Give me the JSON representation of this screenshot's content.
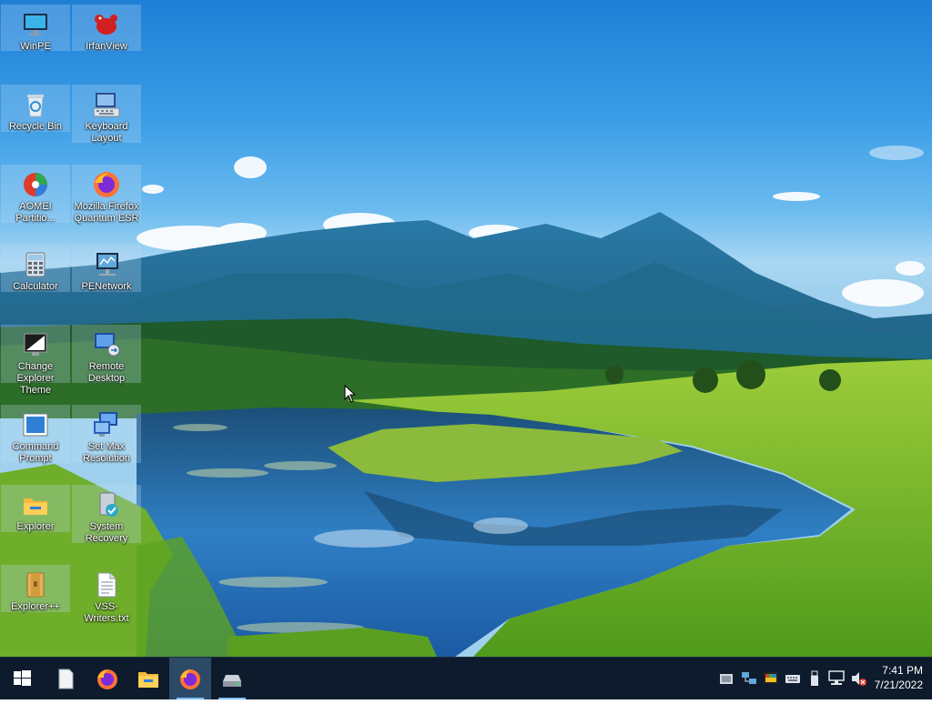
{
  "desktop": {
    "icons": [
      {
        "label": "WinPE",
        "icon": "monitor-icon"
      },
      {
        "label": "IrfanView",
        "icon": "irfanview-icon"
      },
      {
        "label": "Recycle Bin",
        "icon": "recycle-bin-icon"
      },
      {
        "label": "Keyboard Layout",
        "icon": "keyboard-icon"
      },
      {
        "label": "AOMEI Partitio...",
        "icon": "aomei-partition-icon"
      },
      {
        "label": "Mozilla Firefox Quantum ESR",
        "icon": "firefox-icon"
      },
      {
        "label": "Calculator",
        "icon": "calculator-icon"
      },
      {
        "label": "PENetwork",
        "icon": "network-icon"
      },
      {
        "label": "Change Explorer Theme",
        "icon": "theme-icon"
      },
      {
        "label": "Remote Desktop",
        "icon": "remote-desktop-icon"
      },
      {
        "label": "Command Prompt",
        "icon": "command-prompt-icon"
      },
      {
        "label": "Set Max Resolution",
        "icon": "resolution-icon"
      },
      {
        "label": "Explorer",
        "icon": "folder-icon"
      },
      {
        "label": "System Recovery",
        "icon": "system-recovery-icon"
      },
      {
        "label": "Explorer++",
        "icon": "explorer-plus-icon"
      },
      {
        "label": "VSS-Writers.txt",
        "icon": "text-file-icon"
      }
    ]
  },
  "taskbar": {
    "pinned": [
      "start-icon",
      "document-icon",
      "firefox-icon",
      "file-explorer-icon",
      "firefox-icon",
      "drive-icon"
    ],
    "tray_icons": [
      "notification-icon",
      "network-share-icon",
      "color-icon",
      "keyboard-icon",
      "usb-icon",
      "network-icon",
      "volume-muted-icon"
    ],
    "time": "7:41 PM",
    "date": "7/21/2022"
  },
  "colors": {
    "taskbar": "#0d1b2c",
    "active_button": "#2c4a66"
  }
}
